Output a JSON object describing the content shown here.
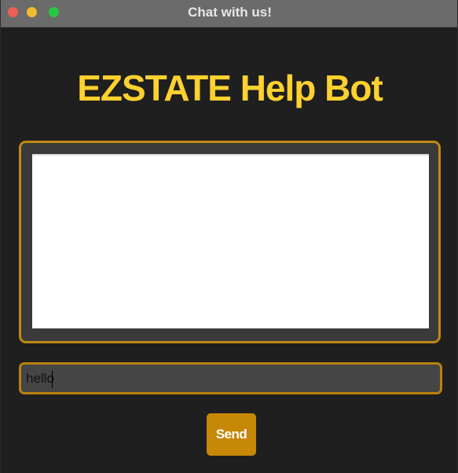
{
  "window": {
    "title": "Chat with us!"
  },
  "app": {
    "heading": "EZSTATE Help Bot",
    "accent_color": "#fed12f",
    "border_color": "#c08a14"
  },
  "chat": {
    "messages": []
  },
  "input": {
    "value": "hello"
  },
  "send": {
    "label": "Send",
    "color": "#c78707"
  }
}
